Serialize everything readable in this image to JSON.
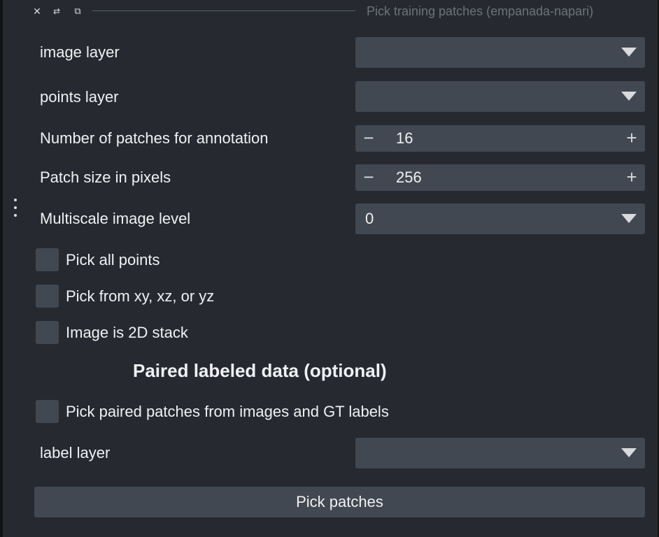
{
  "titlebar": {
    "close_glyph": "✕",
    "float_glyph": "⇄",
    "popout_glyph": "⧉",
    "title": "Pick training patches (empanada-napari)"
  },
  "form": {
    "image_layer": {
      "label": "image layer",
      "value": ""
    },
    "points_layer": {
      "label": "points layer",
      "value": ""
    },
    "num_patches": {
      "label": "Number of patches for annotation",
      "value": "16",
      "minus": "−",
      "plus": "+"
    },
    "patch_size": {
      "label": "Patch size in pixels",
      "value": "256",
      "minus": "−",
      "plus": "+"
    },
    "multiscale_level": {
      "label": "Multiscale image level",
      "value": "0"
    },
    "pick_all_points": {
      "label": "Pick all points",
      "checked": false
    },
    "pick_from_planes": {
      "label": "Pick from xy, xz, or yz",
      "checked": false
    },
    "image_2d_stack": {
      "label": "Image is 2D stack",
      "checked": false
    }
  },
  "paired_section": {
    "title": "Paired labeled data (optional)",
    "pick_paired": {
      "label": "Pick paired patches from images and GT labels",
      "checked": false
    },
    "label_layer": {
      "label": "label layer",
      "value": ""
    }
  },
  "actions": {
    "pick_patches_label": "Pick patches"
  },
  "colors": {
    "background": "#262930",
    "control": "#414851",
    "text": "#f0f1f2",
    "muted_title": "#6d727b"
  },
  "icons": [
    "close-icon",
    "float-icon",
    "popout-icon",
    "drag-handle-icon",
    "dropdown-arrow-icon",
    "minus-icon",
    "plus-icon"
  ]
}
